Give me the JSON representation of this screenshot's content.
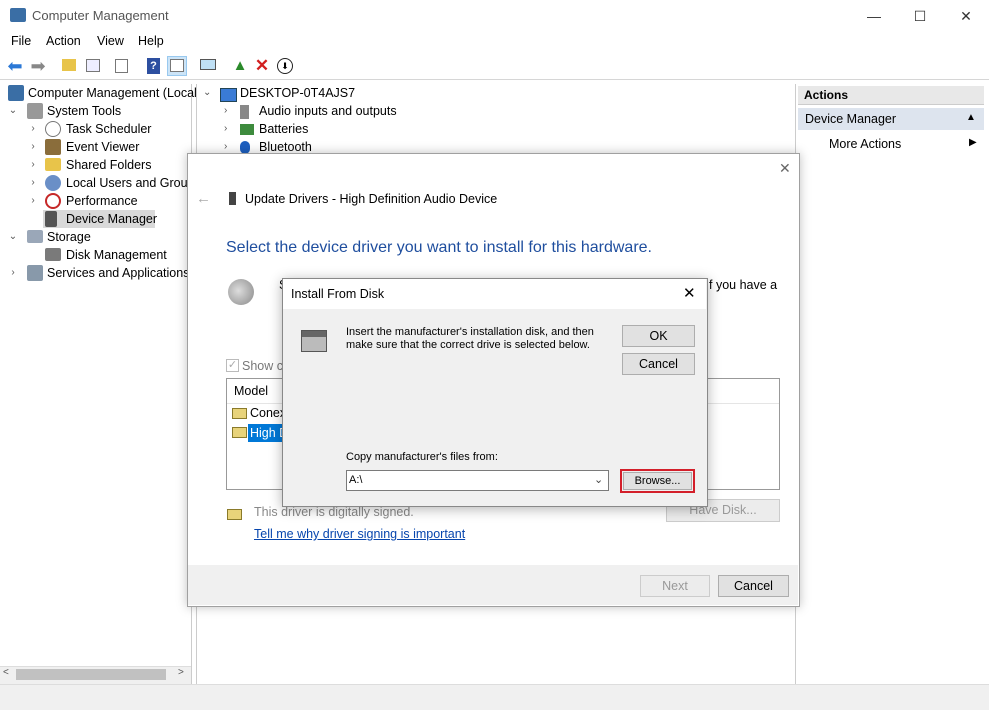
{
  "window": {
    "title": "Computer Management",
    "minimize": "—",
    "maximize": "☐",
    "close": "✕"
  },
  "menu": [
    "File",
    "Action",
    "View",
    "Help"
  ],
  "tree": {
    "root": "Computer Management (Local",
    "system_tools": "System Tools",
    "task_scheduler": "Task Scheduler",
    "event_viewer": "Event Viewer",
    "shared_folders": "Shared Folders",
    "local_users": "Local Users and Groups",
    "performance": "Performance",
    "device_manager": "Device Manager",
    "storage": "Storage",
    "disk_management": "Disk Management",
    "services": "Services and Applications"
  },
  "devices": {
    "computer": "DESKTOP-0T4AJS7",
    "items": [
      "Audio inputs and outputs",
      "Batteries",
      "Bluetooth"
    ]
  },
  "actions": {
    "header": "Actions",
    "selected": "Device Manager",
    "more": "More Actions"
  },
  "wizard": {
    "title": "Update Drivers - High Definition Audio Device",
    "heading": "Select the device driver you want to install for this hardware.",
    "desc_start": "S",
    "desc_end": "f you have a",
    "show_compatible": "Show co",
    "model_header": "Model",
    "models": [
      "Conex",
      "High D"
    ],
    "signed": "This driver is digitally signed.",
    "signing_link": "Tell me why driver signing is important",
    "have_disk": "Have Disk...",
    "next": "Next",
    "cancel": "Cancel"
  },
  "dialog": {
    "title": "Install From Disk",
    "message": "Insert the manufacturer's installation disk, and then make sure that the correct drive is selected below.",
    "ok": "OK",
    "cancel": "Cancel",
    "copy_label": "Copy manufacturer's files from:",
    "path": "A:\\",
    "browse": "Browse..."
  }
}
